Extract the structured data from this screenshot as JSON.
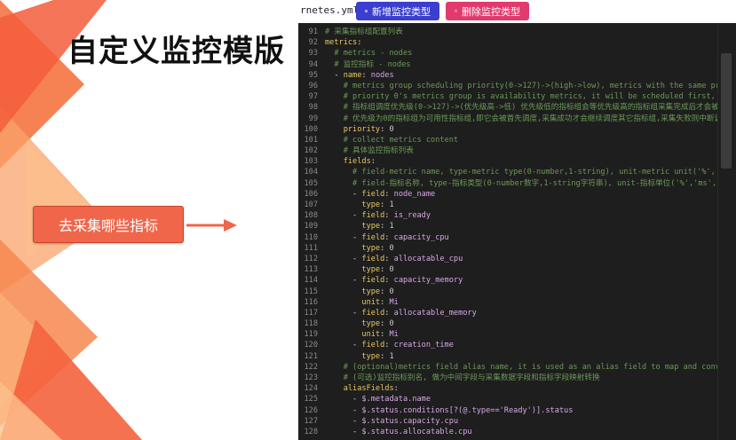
{
  "slide": {
    "title": "自定义监控模版",
    "callout": "去采集哪些指标"
  },
  "editor": {
    "file_tab": "rnetes.yml",
    "buttons": {
      "add": "新增监控类型",
      "delete": "删除监控类型"
    },
    "lines": [
      {
        "n": "91",
        "parts": [
          {
            "t": "c",
            "v": "# 采集指标组配置列表"
          }
        ]
      },
      {
        "n": "92",
        "parts": [
          {
            "t": "k",
            "v": "metrics"
          },
          {
            "t": "p",
            "v": ":"
          }
        ]
      },
      {
        "n": "93",
        "parts": [
          {
            "t": "p",
            "v": "  "
          },
          {
            "t": "c",
            "v": "# metrics - nodes"
          }
        ]
      },
      {
        "n": "94",
        "parts": [
          {
            "t": "p",
            "v": "  "
          },
          {
            "t": "c",
            "v": "# 监控指标 - nodes"
          }
        ]
      },
      {
        "n": "95",
        "parts": [
          {
            "t": "p",
            "v": "  - "
          },
          {
            "t": "k",
            "v": "name"
          },
          {
            "t": "p",
            "v": ": "
          },
          {
            "t": "s",
            "v": "nodes"
          }
        ]
      },
      {
        "n": "96",
        "parts": [
          {
            "t": "p",
            "v": "    "
          },
          {
            "t": "c",
            "v": "# metrics group scheduling priority(0->127)->(high->low), metrics with the same prio"
          }
        ]
      },
      {
        "n": "97",
        "parts": [
          {
            "t": "p",
            "v": "    "
          },
          {
            "t": "c",
            "v": "# priority 0's metrics group is availability metrics, it will be scheduled first, on"
          }
        ]
      },
      {
        "n": "98",
        "parts": [
          {
            "t": "p",
            "v": "    "
          },
          {
            "t": "c",
            "v": "# 指标组调度优先级(0->127)->(优先级高->低) 优先级低的指标组会等优先级高的指标组采集完成后才会被调度"
          }
        ]
      },
      {
        "n": "99",
        "parts": [
          {
            "t": "p",
            "v": "    "
          },
          {
            "t": "c",
            "v": "# 优先级为0的指标组为可用性指标组,即它会被首先调度,采集成功才会继续调度其它指标组,采集失败则中断调度"
          }
        ]
      },
      {
        "n": "100",
        "parts": [
          {
            "t": "p",
            "v": "    "
          },
          {
            "t": "k",
            "v": "priority"
          },
          {
            "t": "p",
            "v": ": "
          },
          {
            "t": "n",
            "v": "0"
          }
        ]
      },
      {
        "n": "101",
        "parts": [
          {
            "t": "p",
            "v": "    "
          },
          {
            "t": "c",
            "v": "# collect metrics content"
          }
        ]
      },
      {
        "n": "102",
        "parts": [
          {
            "t": "p",
            "v": "    "
          },
          {
            "t": "c",
            "v": "# 具体监控指标列表"
          }
        ]
      },
      {
        "n": "103",
        "parts": [
          {
            "t": "p",
            "v": "    "
          },
          {
            "t": "k",
            "v": "fields"
          },
          {
            "t": "p",
            "v": ":"
          }
        ]
      },
      {
        "n": "104",
        "parts": [
          {
            "t": "p",
            "v": "      "
          },
          {
            "t": "c",
            "v": "# field-metric name, type-metric type(0-number,1-string), unit-metric unit('%','ms"
          }
        ]
      },
      {
        "n": "105",
        "parts": [
          {
            "t": "p",
            "v": "      "
          },
          {
            "t": "c",
            "v": "# field-指标名称, type-指标类型(0-number数字,1-string字符串), unit-指标单位('%','ms','MB"
          }
        ]
      },
      {
        "n": "106",
        "parts": [
          {
            "t": "p",
            "v": "      - "
          },
          {
            "t": "k",
            "v": "field"
          },
          {
            "t": "p",
            "v": ": "
          },
          {
            "t": "s",
            "v": "node_name"
          }
        ]
      },
      {
        "n": "107",
        "parts": [
          {
            "t": "p",
            "v": "        "
          },
          {
            "t": "k",
            "v": "type"
          },
          {
            "t": "p",
            "v": ": "
          },
          {
            "t": "n",
            "v": "1"
          }
        ]
      },
      {
        "n": "108",
        "parts": [
          {
            "t": "p",
            "v": "      - "
          },
          {
            "t": "k",
            "v": "field"
          },
          {
            "t": "p",
            "v": ": "
          },
          {
            "t": "s",
            "v": "is_ready"
          }
        ]
      },
      {
        "n": "109",
        "parts": [
          {
            "t": "p",
            "v": "        "
          },
          {
            "t": "k",
            "v": "type"
          },
          {
            "t": "p",
            "v": ": "
          },
          {
            "t": "n",
            "v": "1"
          }
        ]
      },
      {
        "n": "110",
        "parts": [
          {
            "t": "p",
            "v": "      - "
          },
          {
            "t": "k",
            "v": "field"
          },
          {
            "t": "p",
            "v": ": "
          },
          {
            "t": "s",
            "v": "capacity_cpu"
          }
        ]
      },
      {
        "n": "111",
        "parts": [
          {
            "t": "p",
            "v": "        "
          },
          {
            "t": "k",
            "v": "type"
          },
          {
            "t": "p",
            "v": ": "
          },
          {
            "t": "n",
            "v": "0"
          }
        ]
      },
      {
        "n": "112",
        "parts": [
          {
            "t": "p",
            "v": "      - "
          },
          {
            "t": "k",
            "v": "field"
          },
          {
            "t": "p",
            "v": ": "
          },
          {
            "t": "s",
            "v": "allocatable_cpu"
          }
        ]
      },
      {
        "n": "113",
        "parts": [
          {
            "t": "p",
            "v": "        "
          },
          {
            "t": "k",
            "v": "type"
          },
          {
            "t": "p",
            "v": ": "
          },
          {
            "t": "n",
            "v": "0"
          }
        ]
      },
      {
        "n": "114",
        "parts": [
          {
            "t": "p",
            "v": "      - "
          },
          {
            "t": "k",
            "v": "field"
          },
          {
            "t": "p",
            "v": ": "
          },
          {
            "t": "s",
            "v": "capacity_memory"
          }
        ]
      },
      {
        "n": "115",
        "parts": [
          {
            "t": "p",
            "v": "        "
          },
          {
            "t": "k",
            "v": "type"
          },
          {
            "t": "p",
            "v": ": "
          },
          {
            "t": "n",
            "v": "0"
          }
        ]
      },
      {
        "n": "116",
        "parts": [
          {
            "t": "p",
            "v": "        "
          },
          {
            "t": "k",
            "v": "unit"
          },
          {
            "t": "p",
            "v": ": "
          },
          {
            "t": "s",
            "v": "Mi"
          }
        ]
      },
      {
        "n": "117",
        "parts": [
          {
            "t": "p",
            "v": "      - "
          },
          {
            "t": "k",
            "v": "field"
          },
          {
            "t": "p",
            "v": ": "
          },
          {
            "t": "s",
            "v": "allocatable_memory"
          }
        ]
      },
      {
        "n": "118",
        "parts": [
          {
            "t": "p",
            "v": "        "
          },
          {
            "t": "k",
            "v": "type"
          },
          {
            "t": "p",
            "v": ": "
          },
          {
            "t": "n",
            "v": "0"
          }
        ]
      },
      {
        "n": "119",
        "parts": [
          {
            "t": "p",
            "v": "        "
          },
          {
            "t": "k",
            "v": "unit"
          },
          {
            "t": "p",
            "v": ": "
          },
          {
            "t": "s",
            "v": "Mi"
          }
        ]
      },
      {
        "n": "120",
        "parts": [
          {
            "t": "p",
            "v": "      - "
          },
          {
            "t": "k",
            "v": "field"
          },
          {
            "t": "p",
            "v": ": "
          },
          {
            "t": "s",
            "v": "creation_time"
          }
        ]
      },
      {
        "n": "121",
        "parts": [
          {
            "t": "p",
            "v": "        "
          },
          {
            "t": "k",
            "v": "type"
          },
          {
            "t": "p",
            "v": ": "
          },
          {
            "t": "n",
            "v": "1"
          }
        ]
      },
      {
        "n": "122",
        "parts": [
          {
            "t": "p",
            "v": "    "
          },
          {
            "t": "c",
            "v": "# (optional)metrics field alias name, it is used as an alias field to map and conver"
          }
        ]
      },
      {
        "n": "123",
        "parts": [
          {
            "t": "p",
            "v": "    "
          },
          {
            "t": "c",
            "v": "# (可选)监控指标别名, 做为中间字段与采集数据字段和指标字段映射转换"
          }
        ]
      },
      {
        "n": "124",
        "parts": [
          {
            "t": "p",
            "v": "    "
          },
          {
            "t": "k",
            "v": "aliasFields"
          },
          {
            "t": "p",
            "v": ":"
          }
        ]
      },
      {
        "n": "125",
        "parts": [
          {
            "t": "p",
            "v": "      - "
          },
          {
            "t": "s",
            "v": "$.metadata.name"
          }
        ]
      },
      {
        "n": "126",
        "parts": [
          {
            "t": "p",
            "v": "      - "
          },
          {
            "t": "s",
            "v": "$.status.conditions[?(@.type=='Ready')].status"
          }
        ]
      },
      {
        "n": "127",
        "parts": [
          {
            "t": "p",
            "v": "      - "
          },
          {
            "t": "s",
            "v": "$.status.capacity.cpu"
          }
        ]
      },
      {
        "n": "128",
        "parts": [
          {
            "t": "p",
            "v": "      - "
          },
          {
            "t": "s",
            "v": "$.status.allocatable.cpu"
          }
        ]
      }
    ]
  },
  "colors": {
    "accent_orange": "#f0664a",
    "add_button": "#3b3ecf",
    "delete_button": "#e23a6e",
    "editor_bg": "#1e1e1e"
  }
}
